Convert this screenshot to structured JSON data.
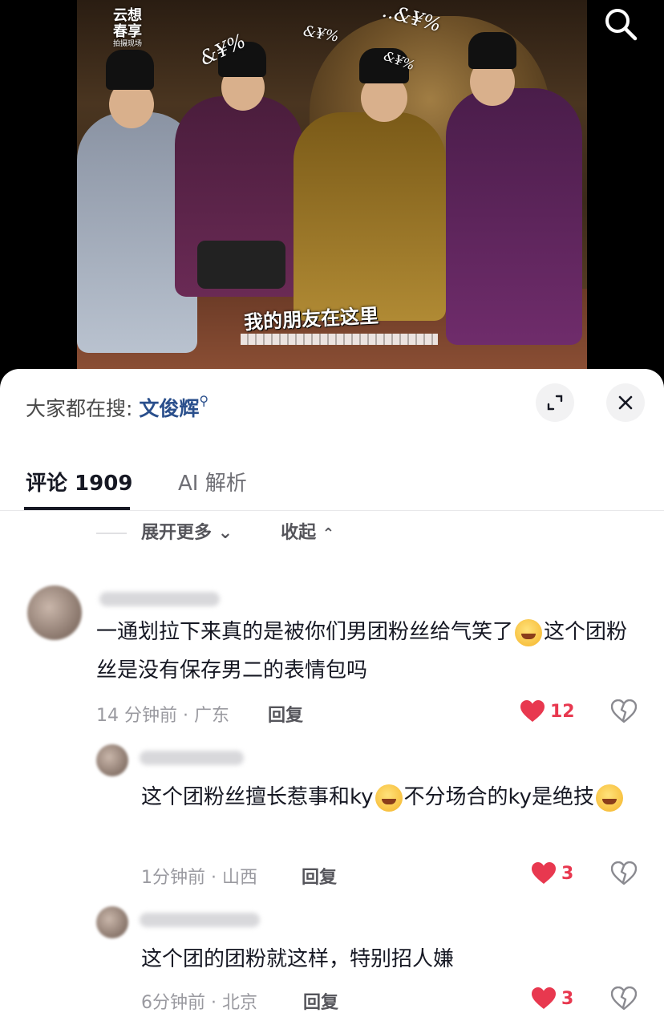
{
  "video": {
    "watermark": "云想春享",
    "watermark_sub": "拍摄现场",
    "overlay_symbols": [
      "&¥%",
      "&¥%",
      "..&¥%",
      "&¥%"
    ],
    "subtitle": "我的朋友在这里"
  },
  "sheet": {
    "hot_search_prefix": "大家都在搜:",
    "hot_search_keyword": "文俊辉",
    "tabs": [
      {
        "label": "评论 1909",
        "active": true
      },
      {
        "label": "AI 解析",
        "active": false
      }
    ],
    "expand_more": "展开更多",
    "collapse": "收起"
  },
  "comments": [
    {
      "text_a": "一通划拉下来真的是被你们男团粉丝给气笑了",
      "text_b": "这个团粉丝是没有保存男二的表情包吗",
      "emoji": "woozy-face",
      "time_location": "14 分钟前 · 广东",
      "reply": "回复",
      "likes": "12"
    },
    {
      "text_a": "这个团粉丝擅长惹事和ky",
      "text_b": "不分场合的ky是绝技",
      "emoji": "grinning-sweat-face",
      "time_location": "1分钟前 · 山西",
      "reply": "回复",
      "likes": "3"
    },
    {
      "text_a": "这个团的团粉就这样，特别招人嫌",
      "time_location": "6分钟前 · 北京",
      "reply": "回复",
      "likes": "3"
    }
  ],
  "colors": {
    "like": "#e8384f",
    "keyword": "#2a4f8c",
    "tab_underline": "#161823"
  }
}
